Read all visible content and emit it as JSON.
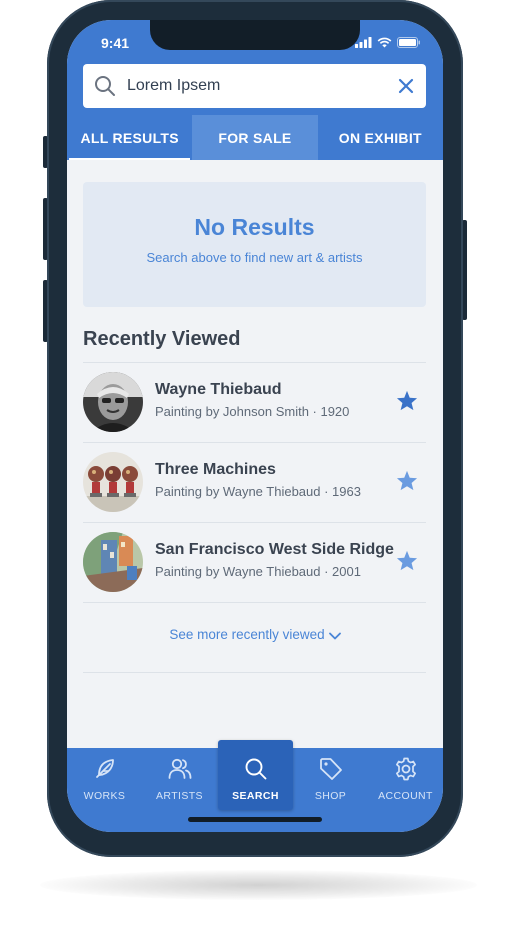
{
  "status_bar": {
    "time": "9:41"
  },
  "search": {
    "value": "Lorem Ipsem",
    "placeholder": ""
  },
  "tabs": [
    {
      "label": "ALL RESULTS",
      "active": true
    },
    {
      "label": "FOR SALE",
      "active": false
    },
    {
      "label": "ON EXHIBIT",
      "active": false
    }
  ],
  "no_results": {
    "title": "No Results",
    "subtitle": "Search above to find new art & artists"
  },
  "recently_viewed": {
    "title": "Recently Viewed",
    "items": [
      {
        "name": "Wayne Thiebaud",
        "meta": "Painting by Johnson Smith ·  1920",
        "starred": true
      },
      {
        "name": "Three Machines",
        "meta": "Painting by Wayne Thiebaud · 1963",
        "starred": false
      },
      {
        "name": "San Francisco West Side Ridge",
        "meta": "Painting by Wayne Thiebaud · 2001",
        "starred": false
      }
    ],
    "see_more": "See more recently viewed"
  },
  "tabbar": [
    {
      "label": "WORKS",
      "icon": "feather-icon"
    },
    {
      "label": "ARTISTS",
      "icon": "users-icon"
    },
    {
      "label": "SEARCH",
      "icon": "search-icon",
      "active": true
    },
    {
      "label": "SHOP",
      "icon": "tag-icon"
    },
    {
      "label": "ACCOUNT",
      "icon": "gear-icon"
    }
  ],
  "colors": {
    "primary": "#3f7ad0",
    "primary_dark": "#2b63b8",
    "accent_text": "#4a85d6",
    "star_filled": "#3a72c8",
    "star_light": "#6a9be0",
    "background": "#f1f3f6"
  }
}
